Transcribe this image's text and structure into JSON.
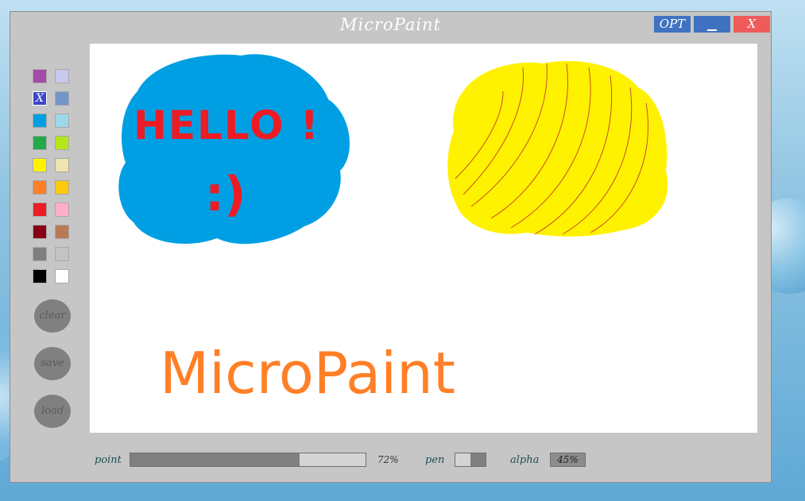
{
  "window": {
    "title": "MicroPaint",
    "opt_label": "OPT",
    "close_label": "X"
  },
  "palette": {
    "selected_mark": "X",
    "colors": [
      [
        "#a54aa8",
        "#c8c8ec"
      ],
      [
        "#3c48cc",
        "#7395c8"
      ],
      [
        "#009fe3",
        "#9fd7ea"
      ],
      [
        "#22a94a",
        "#b5e61d"
      ],
      [
        "#fff200",
        "#efe4b0"
      ],
      [
        "#ff7f27",
        "#ffc90e"
      ],
      [
        "#ed1c24",
        "#ffaec9"
      ],
      [
        "#880015",
        "#b97a57"
      ],
      [
        "#7f7f7f",
        "#c3c3c3"
      ],
      [
        "#000000",
        "#ffffff"
      ]
    ],
    "selected_index": [
      1,
      0
    ]
  },
  "sidebar": {
    "clear_label": "clear",
    "save_label": "save",
    "load_label": "load"
  },
  "canvas": {
    "hello_text": "HELLO !",
    "smiley_text": ":)",
    "brand_text": "MicroPaint"
  },
  "controls": {
    "point_label": "point",
    "point_value": "72%",
    "point_fraction": 0.72,
    "pen_label": "pen",
    "alpha_label": "alpha",
    "alpha_value": "45%"
  }
}
